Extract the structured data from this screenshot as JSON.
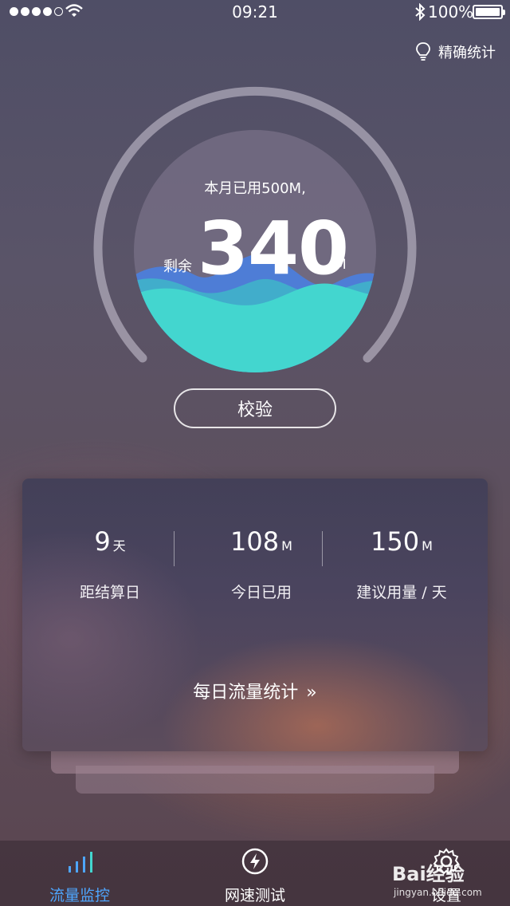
{
  "status_bar": {
    "time": "09:21",
    "battery": "100%",
    "icons": [
      "signal-dots",
      "wifi-icon",
      "bluetooth-icon",
      "battery-icon"
    ]
  },
  "header": {
    "precise_stats": "精确统计",
    "icon": "lightbulb-icon"
  },
  "gauge": {
    "used_text": "本月已用500M,",
    "remain_label": "剩余",
    "remain_value": "340",
    "remain_unit": "M"
  },
  "verify_button": "校验",
  "stats": [
    {
      "value": "9",
      "unit": "天",
      "label": "距结算日"
    },
    {
      "value": "108",
      "unit": "M",
      "label": "今日已用"
    },
    {
      "value": "150",
      "unit": "M",
      "label": "建议用量 / 天"
    }
  ],
  "daily_stats": {
    "label": "每日流量统计",
    "chevron": "»"
  },
  "tab_bar": {
    "tabs": [
      {
        "label": "流量监控",
        "icon": "bar-chart-icon",
        "active": true
      },
      {
        "label": "网速测试",
        "icon": "lightning-icon",
        "active": false
      },
      {
        "label": "设置",
        "icon": "gear-icon",
        "active": false
      }
    ]
  },
  "watermark": {
    "brand": "Bai经验",
    "url": "jingyan.baidu.com"
  },
  "colors": {
    "accent_active_tab": "#4ea6ff",
    "wave_teal": "#43d6cf",
    "wave_blue": "#4a7fe0"
  }
}
